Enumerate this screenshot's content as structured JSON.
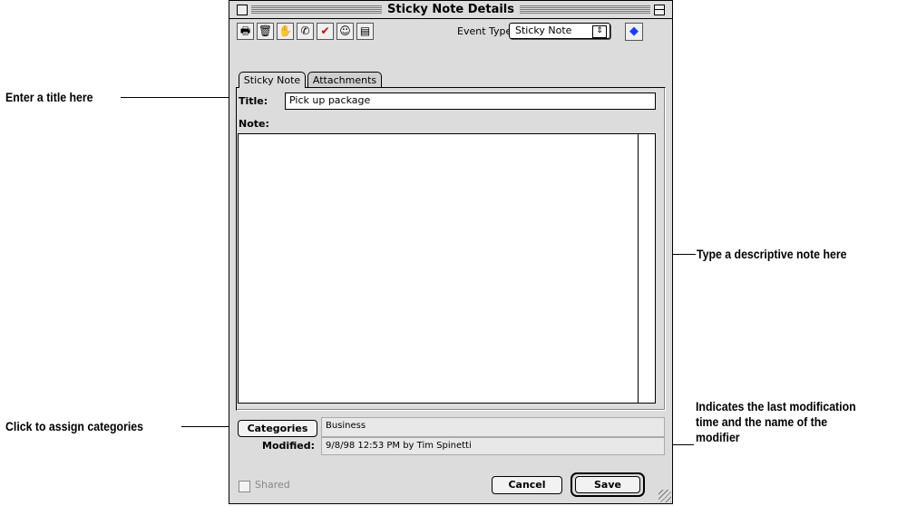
{
  "window": {
    "title": "Sticky Note Details"
  },
  "toolbar": {
    "icons": [
      "printer-icon",
      "trash-icon",
      "handshake-icon",
      "phone-icon",
      "checkmark-icon",
      "contact-card-icon",
      "notepad-icon"
    ],
    "event_type_label": "Event Type:",
    "event_type_value": "Sticky Note",
    "help_glyph": "◆"
  },
  "tabs": [
    {
      "label": "Sticky Note",
      "selected": true
    },
    {
      "label": "Attachments",
      "selected": false
    }
  ],
  "form": {
    "title_label": "Title:",
    "title_value": "Pick up package",
    "note_label": "Note:",
    "note_value": "",
    "categories_button": "Categories",
    "categories_value": "Business",
    "modified_label": "Modified:",
    "modified_value": "9/8/98 12:53 PM by Tim Spinetti",
    "shared_label": "Shared",
    "shared_checked": false,
    "cancel_button": "Cancel",
    "save_button": "Save"
  },
  "callouts": {
    "title": "Enter a title here",
    "note": "Type a descriptive note here",
    "categories": "Click to assign categories",
    "modified_line1": "Indicates the last modification",
    "modified_line2": "time and the name of the",
    "modified_line3": "modifier"
  }
}
